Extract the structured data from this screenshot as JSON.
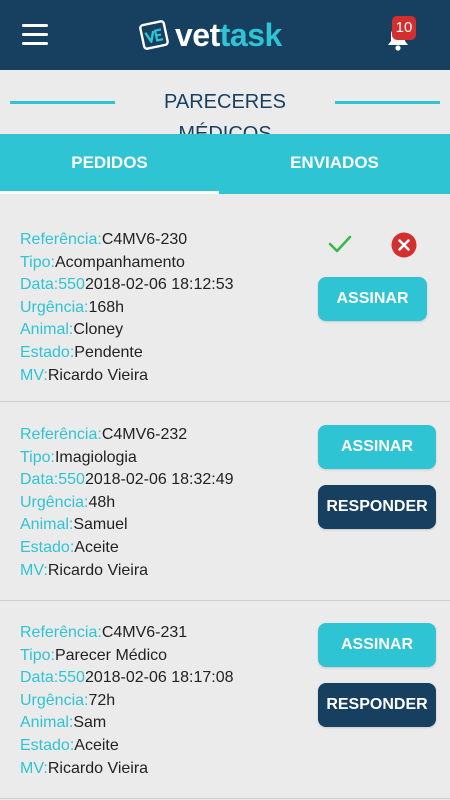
{
  "header": {
    "logo_part1": "vet",
    "logo_part2": "task",
    "notification_count": "10"
  },
  "page": {
    "title": "PARECERES MÉDICOS"
  },
  "tabs": [
    {
      "label": "PEDIDOS",
      "active": true
    },
    {
      "label": "ENVIADOS",
      "active": false
    }
  ],
  "labels": {
    "referencia": "Referência:",
    "tipo": "Tipo:",
    "data": "Data:550",
    "urgencia": "Urgência:",
    "animal": "Animal:",
    "estado": "Estado:",
    "mv": "MV:"
  },
  "buttons": {
    "sign": "ASSINAR",
    "reply": "RESPONDER"
  },
  "requests": [
    {
      "referencia": "C4MV6-230",
      "tipo": "Acompanhamento",
      "data": "2018-02-06 18:12:53",
      "urgencia": "168h",
      "animal": "Cloney",
      "estado": "Pendente",
      "mv": "Ricardo Vieira"
    },
    {
      "referencia": "C4MV6-232",
      "tipo": "Imagiologia",
      "data": "2018-02-06 18:32:49",
      "urgencia": "48h",
      "animal": "Samuel",
      "estado": "Aceite",
      "mv": "Ricardo Vieira"
    },
    {
      "referencia": "C4MV6-231",
      "tipo": "Parecer Médico",
      "data": "2018-02-06 18:17:08",
      "urgencia": "72h",
      "animal": "Sam",
      "estado": "Aceite",
      "mv": "Ricardo Vieira"
    }
  ],
  "colors": {
    "header_bg": "#173f5f",
    "accent": "#2ec4d4",
    "badge": "#d32f2f",
    "accept_icon": "#3cb54a",
    "reject_icon": "#d32f2f"
  },
  "icons": [
    "menu-icon",
    "vettask-logo-icon",
    "bell-icon",
    "check-icon",
    "reject-x-icon"
  ]
}
